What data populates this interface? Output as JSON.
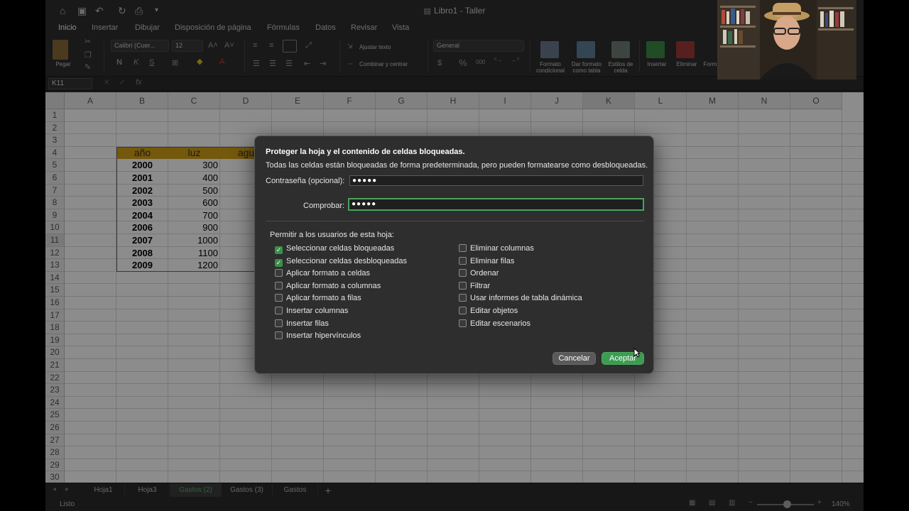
{
  "window": {
    "title": "Libro1 - Taller"
  },
  "tabs": [
    "Inicio",
    "Insertar",
    "Dibujar",
    "Disposición de página",
    "Fórmulas",
    "Datos",
    "Revisar",
    "Vista"
  ],
  "ribbon": {
    "paste_label": "Pegar",
    "font_name": "Calibri (Cuer...",
    "font_size": "12",
    "wrap_text": "Ajustar texto",
    "merge_center": "Combinar y centrar",
    "number_format": "General",
    "cond_format": "Formato condicional",
    "format_table": "Dar formato como tabla",
    "cell_styles": "Estilos de celda",
    "insert": "Insertar",
    "delete": "Eliminar",
    "format": "Form"
  },
  "formula_bar": {
    "name_box": "K11",
    "fx": "fx"
  },
  "columns": [
    "A",
    "B",
    "C",
    "D",
    "E",
    "F",
    "G",
    "H",
    "I",
    "J",
    "K",
    "L",
    "M",
    "N",
    "O"
  ],
  "rows": [
    "1",
    "2",
    "3",
    "4",
    "5",
    "6",
    "7",
    "8",
    "9",
    "10",
    "11",
    "12",
    "13",
    "14",
    "15",
    "16",
    "17",
    "18",
    "19",
    "20",
    "21",
    "22",
    "23",
    "24",
    "25",
    "26",
    "27",
    "28",
    "29",
    "30"
  ],
  "table": {
    "headers": [
      "año",
      "luz",
      "agu"
    ],
    "years": [
      "2000",
      "2001",
      "2002",
      "2003",
      "2004",
      "2006",
      "2007",
      "2008",
      "2009"
    ],
    "luz": [
      "300",
      "400",
      "500",
      "600",
      "700",
      "900",
      "1000",
      "1100",
      "1200"
    ]
  },
  "sheet_tabs": [
    "Hoja1",
    "Hoja3",
    "Gastos (2)",
    "Gastos (3)",
    "Gastos",
    "+"
  ],
  "status": {
    "ready": "Listo",
    "zoom": "140%"
  },
  "dialog": {
    "title": "Proteger la hoja y el contenido de celdas bloqueadas.",
    "description": "Todas las celdas están bloqueadas de forma predeterminada, pero pueden formatearse como desbloqueadas.",
    "password_label": "Contraseña (opcional):",
    "password_value": "●●●●●",
    "verify_label": "Comprobar:",
    "verify_value": "●●●●●",
    "permissions_label": "Permitir a los usuarios de esta hoja:",
    "left_options": [
      {
        "label": "Seleccionar celdas bloqueadas",
        "checked": true
      },
      {
        "label": "Seleccionar celdas desbloqueadas",
        "checked": true
      },
      {
        "label": "Aplicar formato a celdas",
        "checked": false
      },
      {
        "label": "Aplicar formato a columnas",
        "checked": false
      },
      {
        "label": "Aplicar formato a filas",
        "checked": false
      },
      {
        "label": "Insertar columnas",
        "checked": false
      },
      {
        "label": "Insertar filas",
        "checked": false
      },
      {
        "label": "Insertar hipervínculos",
        "checked": false
      }
    ],
    "right_options": [
      {
        "label": "Eliminar columnas",
        "checked": false
      },
      {
        "label": "Eliminar filas",
        "checked": false
      },
      {
        "label": "Ordenar",
        "checked": false
      },
      {
        "label": "Filtrar",
        "checked": false
      },
      {
        "label": "Usar informes de tabla dinámica",
        "checked": false
      },
      {
        "label": "Editar objetos",
        "checked": false
      },
      {
        "label": "Editar escenarios",
        "checked": false
      }
    ],
    "cancel": "Cancelar",
    "ok": "Aceptar"
  },
  "colors": {
    "accent": "#3e9c52",
    "header_fill": "#d4a017",
    "sheet_active": "#58b260"
  }
}
